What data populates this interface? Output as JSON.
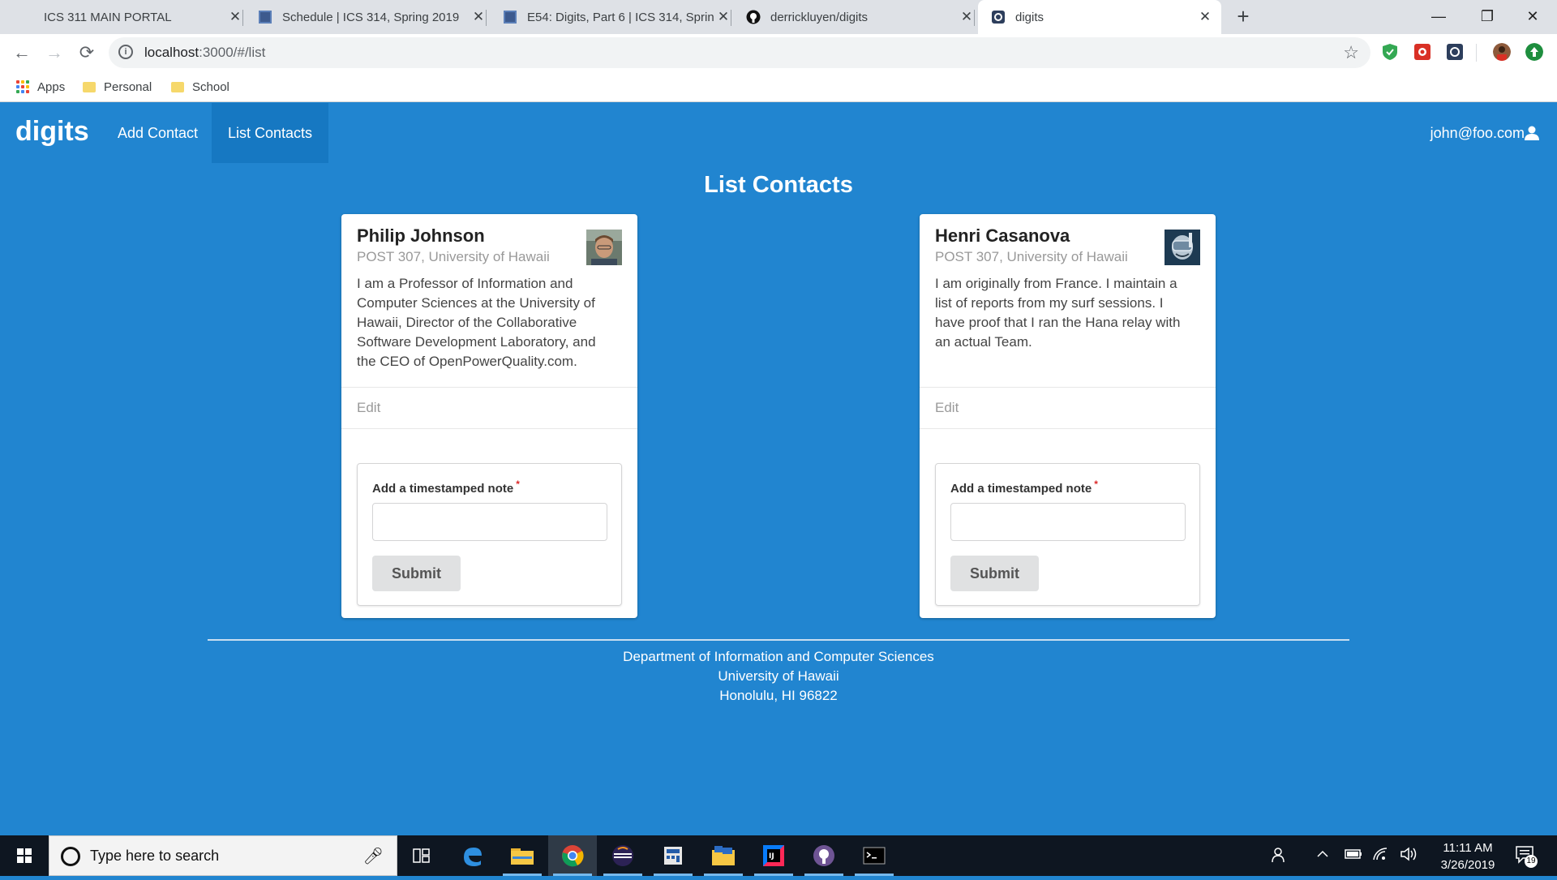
{
  "browser": {
    "tabs": [
      {
        "title": "ICS 311 MAIN PORTAL",
        "icon": "blank-page-icon",
        "active": false
      },
      {
        "title": "Schedule | ICS 314, Spring 2019",
        "icon": "site-icon",
        "active": false
      },
      {
        "title": "E54: Digits, Part 6 | ICS 314, Sprin",
        "icon": "site-icon",
        "active": false
      },
      {
        "title": "derrickluyen/digits",
        "icon": "github-icon",
        "active": false
      },
      {
        "title": "digits",
        "icon": "meteor-icon",
        "active": true
      }
    ],
    "new_tab": "+",
    "window_controls": {
      "minimize": "—",
      "restore": "❐",
      "close": "✕"
    },
    "nav": {
      "back": "←",
      "forward": "→",
      "reload": "⟳"
    },
    "url_host": "localhost",
    "url_path": ":3000/#/list",
    "bookmark_star": "☆",
    "bookmarks": [
      {
        "label": "Apps",
        "icon": "apps-grid-icon"
      },
      {
        "label": "Personal",
        "icon": "folder-icon"
      },
      {
        "label": "School",
        "icon": "folder-icon"
      }
    ]
  },
  "app": {
    "brand": "digits",
    "nav_items": [
      {
        "label": "Add Contact",
        "active": false
      },
      {
        "label": "List Contacts",
        "active": true
      }
    ],
    "user": "john@foo.com",
    "page_title": "List Contacts",
    "contacts": [
      {
        "name": "Philip Johnson",
        "address": "POST 307, University of Hawaii",
        "description": "I am a Professor of Information and Computer Sciences at the University of Hawaii, Director of the Collaborative Software Development Laboratory, and the CEO of OpenPowerQuality.com.",
        "edit": "Edit",
        "note_label": "Add a timestamped note",
        "note_value": "",
        "submit": "Submit"
      },
      {
        "name": "Henri Casanova",
        "address": "POST 307, University of Hawaii",
        "description": "I am originally from France. I maintain a list of reports from my surf sessions. I have proof that I ran the Hana relay with an actual Team.",
        "edit": "Edit",
        "note_label": "Add a timestamped note",
        "note_value": "",
        "submit": "Submit"
      }
    ],
    "footer": {
      "line1": "Department of Information and Computer Sciences",
      "line2": "University of Hawaii",
      "line3": "Honolulu, HI 96822"
    }
  },
  "taskbar": {
    "search_placeholder": "Type here to search",
    "apps": [
      "task-view-icon",
      "edge-icon",
      "file-explorer-icon",
      "chrome-icon",
      "eclipse-icon",
      "calculator-icon",
      "file-manager-icon",
      "intellij-icon",
      "github-desktop-icon",
      "terminal-icon"
    ],
    "time": "11:11 AM",
    "date": "3/26/2019",
    "notification_count": "19"
  },
  "colors": {
    "primary": "#2185d0",
    "nav_active": "#1678c2",
    "card_bg": "#ffffff",
    "muted_text": "#999999",
    "required": "#db2828"
  }
}
